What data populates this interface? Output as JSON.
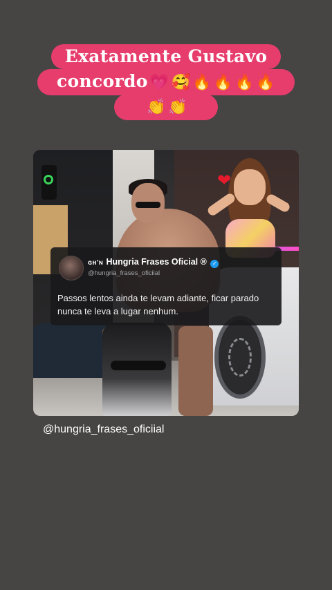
{
  "story": {
    "caption": {
      "line1": "Exatamente Gustavo",
      "line2_text": "concordo",
      "line2_emojis": [
        "💗",
        "🥰",
        "🔥",
        "🔥",
        "🔥",
        "🔥"
      ],
      "line3_emojis": [
        "👏",
        "👏"
      ],
      "highlight_color": "#e63d6d"
    },
    "tweet": {
      "ghn_tag": "ɢʜ'ɴ",
      "account_name": "Hungria Frases Oficial ®",
      "verified_mark": "✓",
      "handle": "@hungria_frases_oficiial",
      "text": "Passos lentos ainda te levam adiante, ficar parado nunca te leva a lugar nenhum."
    },
    "mention": "@hungria_frases_oficiial",
    "background_color": "#474444",
    "accent_verified": "#1d9bf0",
    "icons": {
      "avatar_heart": "heart-icon",
      "verified": "verified-badge-icon"
    },
    "avatar_heart_glyph": "❤"
  }
}
